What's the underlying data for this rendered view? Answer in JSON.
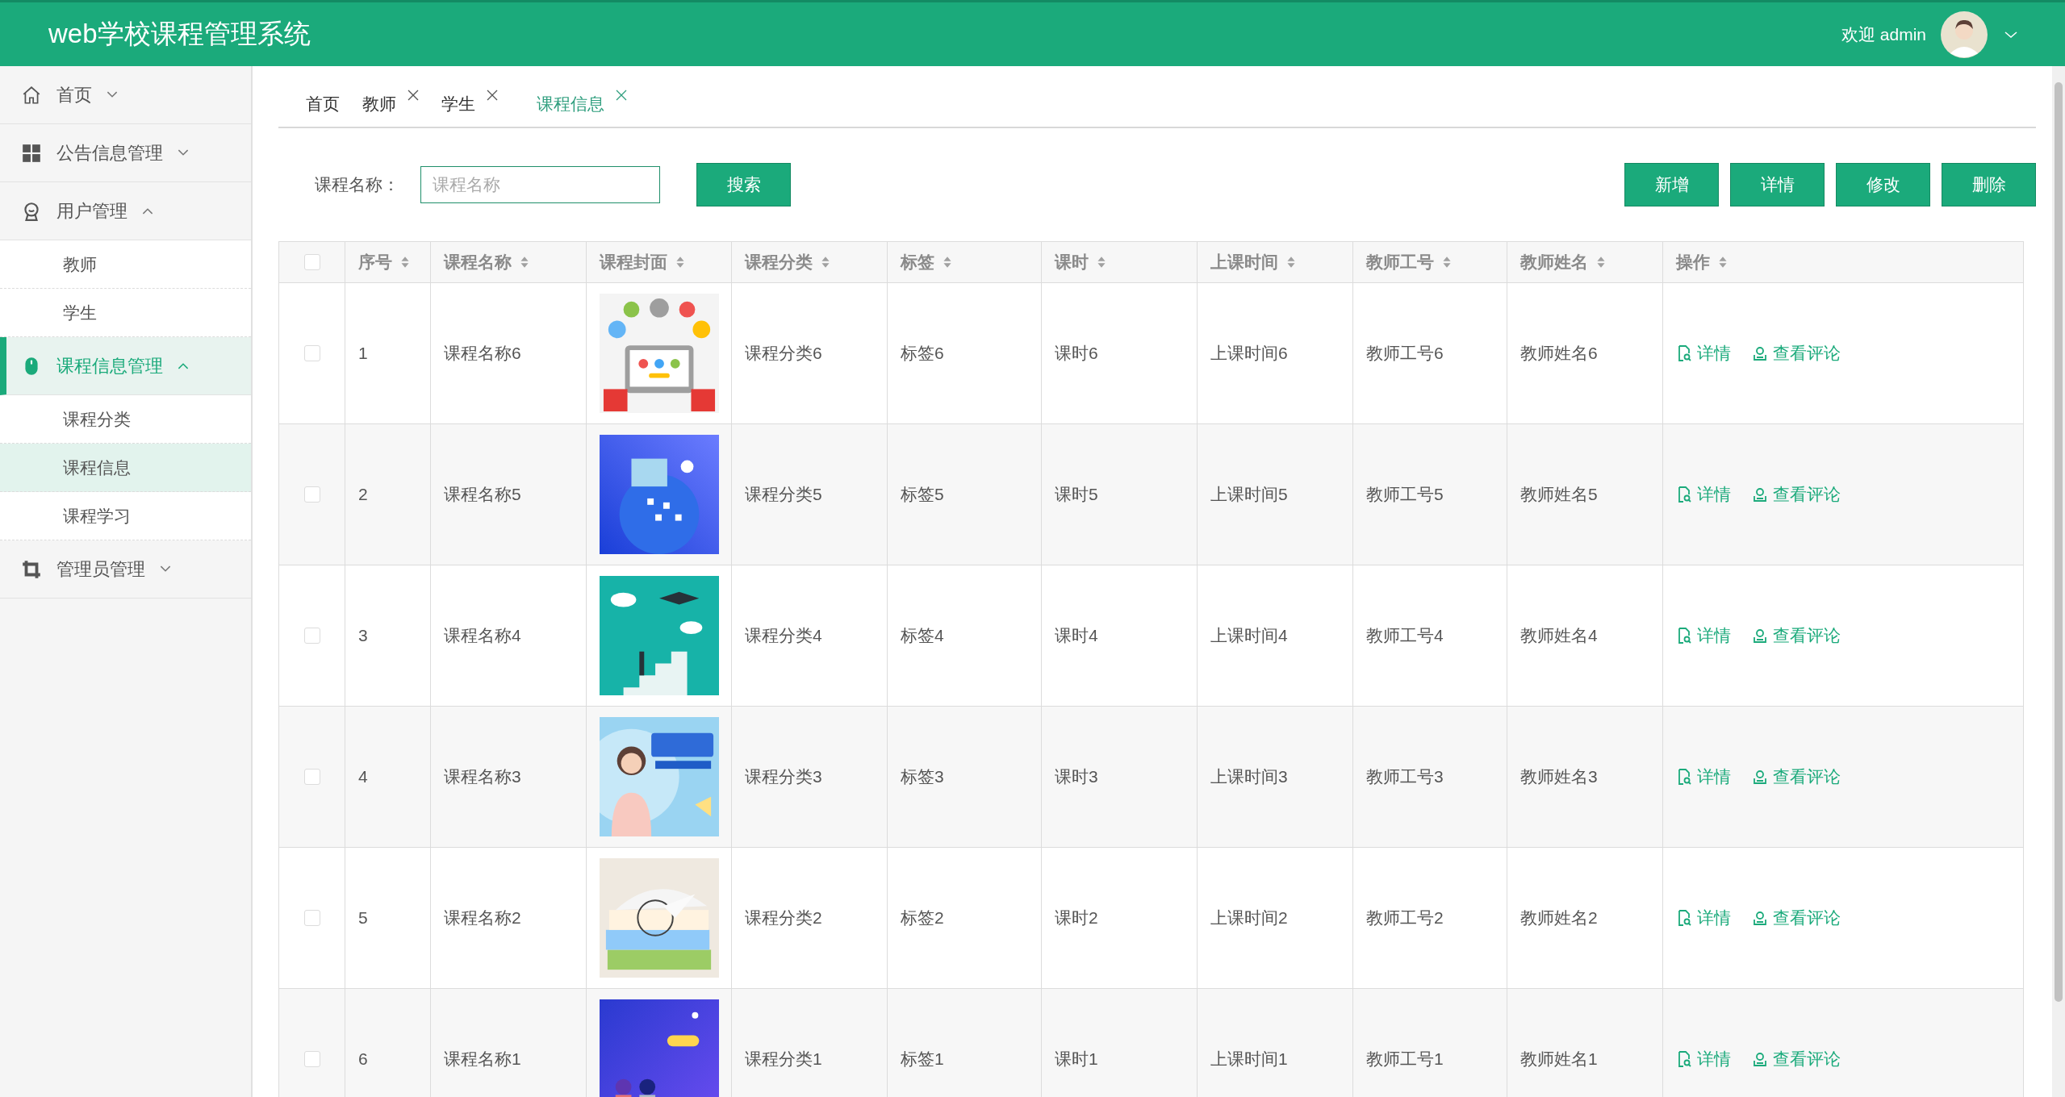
{
  "header": {
    "title": "web学校课程管理系统",
    "welcome": "欢迎 admin"
  },
  "sidebar": [
    {
      "label": "首页",
      "kind": "home",
      "expanded": false,
      "selected": false
    },
    {
      "label": "公告信息管理",
      "kind": "grid",
      "expanded": false,
      "selected": false
    },
    {
      "label": "用户管理",
      "kind": "user",
      "expanded": true,
      "selected": false,
      "children": [
        {
          "label": "教师",
          "selected": false
        },
        {
          "label": "学生",
          "selected": false
        }
      ]
    },
    {
      "label": "课程信息管理",
      "kind": "mouse",
      "expanded": true,
      "selected": true,
      "children": [
        {
          "label": "课程分类",
          "selected": false
        },
        {
          "label": "课程信息",
          "selected": true
        },
        {
          "label": "课程学习",
          "selected": false
        }
      ]
    },
    {
      "label": "管理员管理",
      "kind": "crop",
      "expanded": false,
      "selected": false
    }
  ],
  "tabs": [
    {
      "label": "首页",
      "closable": false,
      "selected": false
    },
    {
      "label": "教师",
      "closable": true,
      "selected": false
    },
    {
      "label": "学生",
      "closable": true,
      "selected": false
    },
    {
      "label": "课程信息",
      "closable": true,
      "selected": true
    }
  ],
  "search": {
    "label": "课程名称：",
    "placeholder": "课程名称",
    "button": "搜索"
  },
  "actions": [
    "新增",
    "详情",
    "修改",
    "删除"
  ],
  "table": {
    "select_all_checked": false,
    "columns": [
      "序号",
      "课程名称",
      "课程封面",
      "课程分类",
      "标签",
      "课时",
      "上课时间",
      "教师工号",
      "教师姓名",
      "操作"
    ],
    "rows": [
      {
        "checked": false,
        "cells": [
          "1",
          "课程名称6",
          null,
          "课程分类6",
          "标签6",
          "课时6",
          "上课时间6",
          "教师工号6",
          "教师姓名6"
        ],
        "links": [
          "详情",
          "查看评论"
        ]
      },
      {
        "checked": false,
        "cells": [
          "2",
          "课程名称5",
          null,
          "课程分类5",
          "标签5",
          "课时5",
          "上课时间5",
          "教师工号5",
          "教师姓名5"
        ],
        "links": [
          "详情",
          "查看评论"
        ]
      },
      {
        "checked": false,
        "cells": [
          "3",
          "课程名称4",
          null,
          "课程分类4",
          "标签4",
          "课时4",
          "上课时间4",
          "教师工号4",
          "教师姓名4"
        ],
        "links": [
          "详情",
          "查看评论"
        ]
      },
      {
        "checked": false,
        "cells": [
          "4",
          "课程名称3",
          null,
          "课程分类3",
          "标签3",
          "课时3",
          "上课时间3",
          "教师工号3",
          "教师姓名3"
        ],
        "links": [
          "详情",
          "查看评论"
        ]
      },
      {
        "checked": false,
        "cells": [
          "5",
          "课程名称2",
          null,
          "课程分类2",
          "标签2",
          "课时2",
          "上课时间2",
          "教师工号2",
          "教师姓名2"
        ],
        "links": [
          "详情",
          "查看评论"
        ]
      },
      {
        "checked": false,
        "cells": [
          "6",
          "课程名称1",
          null,
          "课程分类1",
          "标签1",
          "课时1",
          "上课时间1",
          "教师工号1",
          "教师姓名1"
        ],
        "links": [
          "详情",
          "查看评论"
        ]
      }
    ]
  }
}
